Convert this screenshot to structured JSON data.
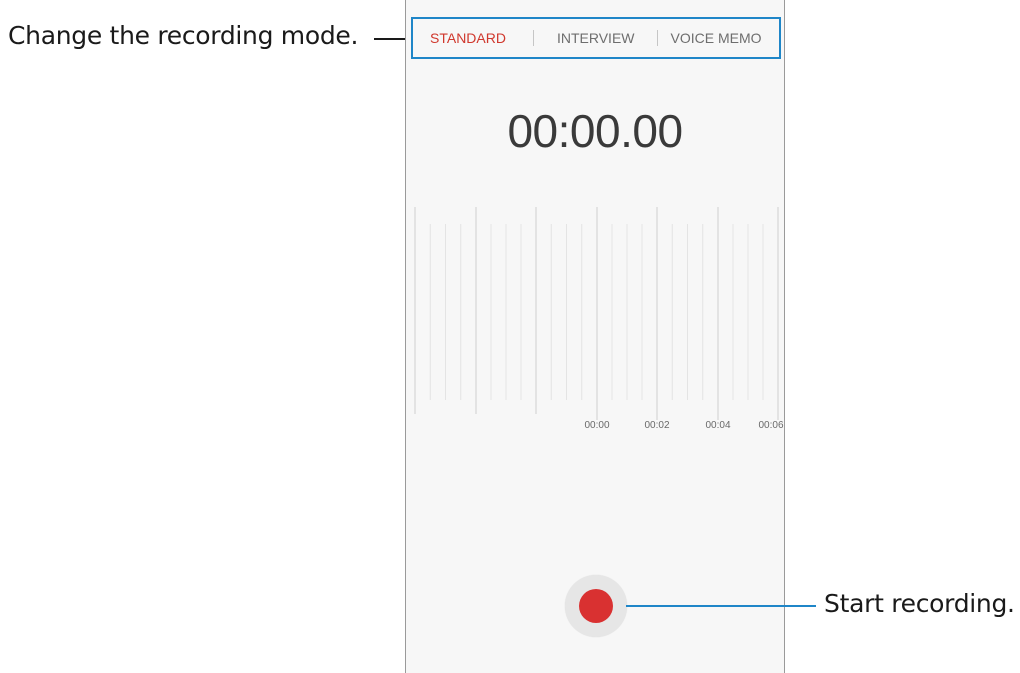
{
  "recorder": {
    "mode_tabs": [
      {
        "label": "STANDARD",
        "active": true
      },
      {
        "label": "INTERVIEW",
        "active": false
      },
      {
        "label": "VOICE MEMO",
        "active": false
      }
    ],
    "timer": "00:00.00",
    "timeline_ticks": [
      "00:00",
      "00:02",
      "00:04",
      "00:06"
    ],
    "record_button": {
      "icon": "record-icon",
      "color": "#d93131"
    }
  },
  "callouts": {
    "mode": "Change the recording mode.",
    "record": "Start recording."
  },
  "colors": {
    "accent": "#d0382d",
    "highlight": "#1f86c8",
    "record": "#d93131"
  }
}
